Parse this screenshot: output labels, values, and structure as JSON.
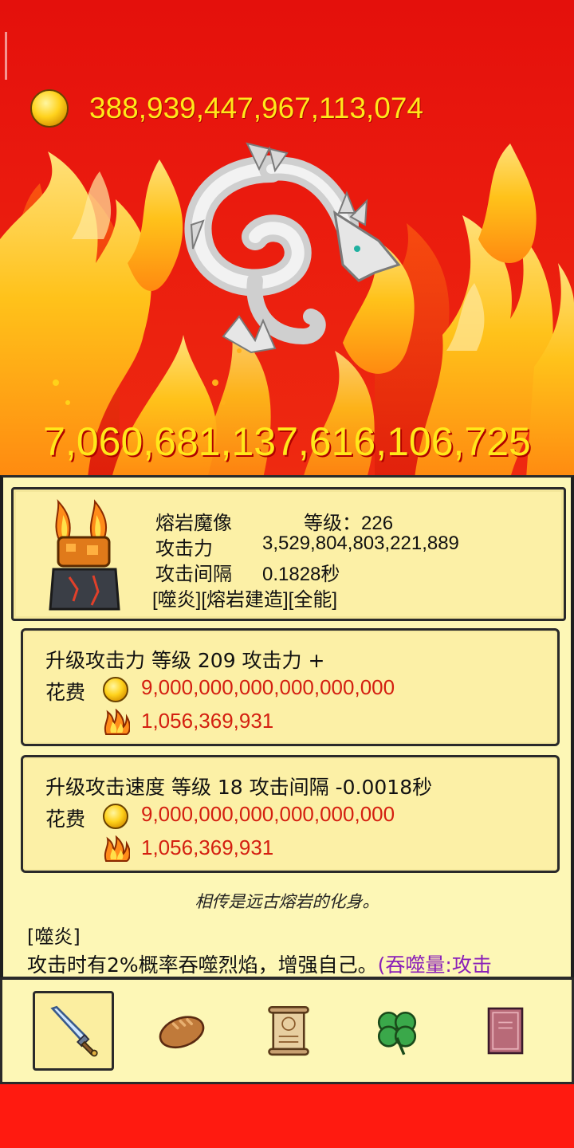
{
  "header": {
    "gold_amount": "388,939,447,967,113,074",
    "damage_total": "7,060,681,137,616,106,725"
  },
  "unit": {
    "name": "熔岩魔像",
    "level": "等级：226",
    "attack_label": "攻击力",
    "attack_value": "3,529,804,803,221,889",
    "interval_label": "攻击间隔",
    "interval_value": "0.1828秒",
    "traits": "[噬炎][熔岩建造][全能]"
  },
  "upgrades": [
    {
      "title": "升级攻击力 等级 209   攻击力 +",
      "cost_label": "花费",
      "gold_cost": "9,000,000,000,000,000,000",
      "flame_cost": "1,056,369,931"
    },
    {
      "title": "升级攻击速度 等级 18 攻击间隔 -0.0018秒",
      "cost_label": "花费",
      "gold_cost": "9,000,000,000,000,000,000",
      "flame_cost": "1,056,369,931"
    }
  ],
  "lore": "相传是远古熔岩的化身。",
  "skill": {
    "name": "[噬炎]",
    "description": "攻击时有2%概率吞噬烈焰，增强自己。",
    "extra": "(吞噬量:攻击"
  },
  "nav": {
    "items": [
      {
        "icon": "sword-icon",
        "active": true
      },
      {
        "icon": "bread-icon",
        "active": false
      },
      {
        "icon": "scroll-icon",
        "active": false
      },
      {
        "icon": "clover-icon",
        "active": false
      },
      {
        "icon": "book-icon",
        "active": false
      }
    ]
  },
  "colors": {
    "background_red": "#e8120e",
    "gold_text": "#ffe81a",
    "panel": "#fdf7b6",
    "cost_red": "#d41f10",
    "skill_purple": "#8a1fb8"
  }
}
